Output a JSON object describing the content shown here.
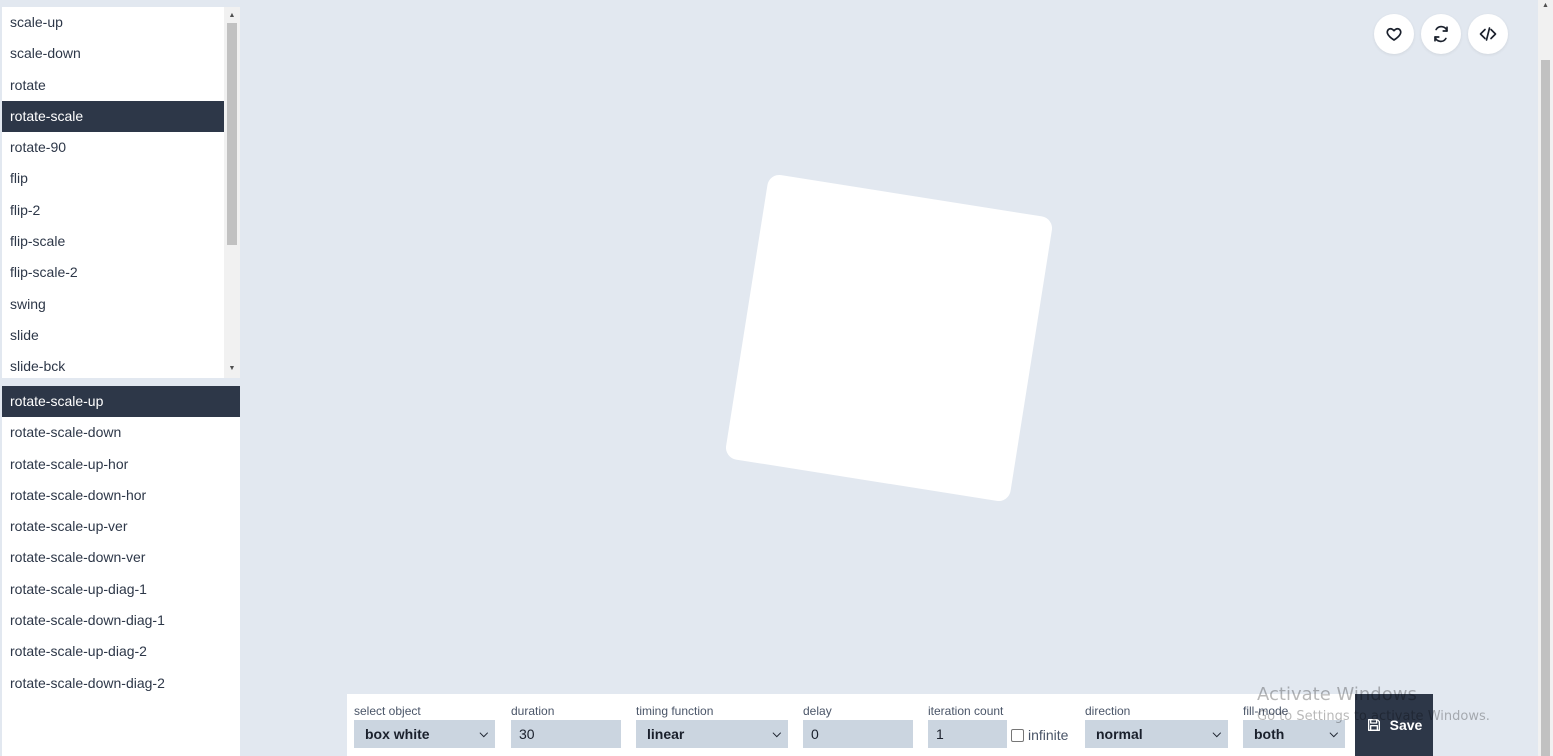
{
  "animation_list": {
    "items": [
      "scale-up",
      "scale-down",
      "rotate",
      "rotate-scale",
      "rotate-90",
      "flip",
      "flip-2",
      "flip-scale",
      "flip-scale-2",
      "swing",
      "slide",
      "slide-bck"
    ],
    "selected": "rotate-scale"
  },
  "variant_list": {
    "items": [
      "rotate-scale-up",
      "rotate-scale-down",
      "rotate-scale-up-hor",
      "rotate-scale-down-hor",
      "rotate-scale-up-ver",
      "rotate-scale-down-ver",
      "rotate-scale-up-diag-1",
      "rotate-scale-down-diag-1",
      "rotate-scale-up-diag-2",
      "rotate-scale-down-diag-2"
    ],
    "selected": "rotate-scale-up"
  },
  "toolbar": {
    "favorite_icon": "heart-icon",
    "replay_icon": "refresh-icon",
    "code_icon": "code-icon"
  },
  "controls": {
    "select_object": {
      "label": "select object",
      "value": "box white"
    },
    "duration": {
      "label": "duration",
      "value": "30"
    },
    "timing_function": {
      "label": "timing function",
      "value": "linear"
    },
    "delay": {
      "label": "delay",
      "value": "0"
    },
    "iteration_count": {
      "label": "iteration count",
      "value": "1",
      "infinite_label": "infinite",
      "infinite_checked": false
    },
    "direction": {
      "label": "direction",
      "value": "normal"
    },
    "fill_mode": {
      "label": "fill-mode",
      "value": "both"
    },
    "save_label": "Save"
  },
  "watermark": {
    "line1": "Activate Windows",
    "line2": "Go to Settings to activate Windows."
  },
  "colors": {
    "background": "#e2e8f0",
    "accent_dark": "#2d3748",
    "field_bg": "#cbd5e0"
  }
}
